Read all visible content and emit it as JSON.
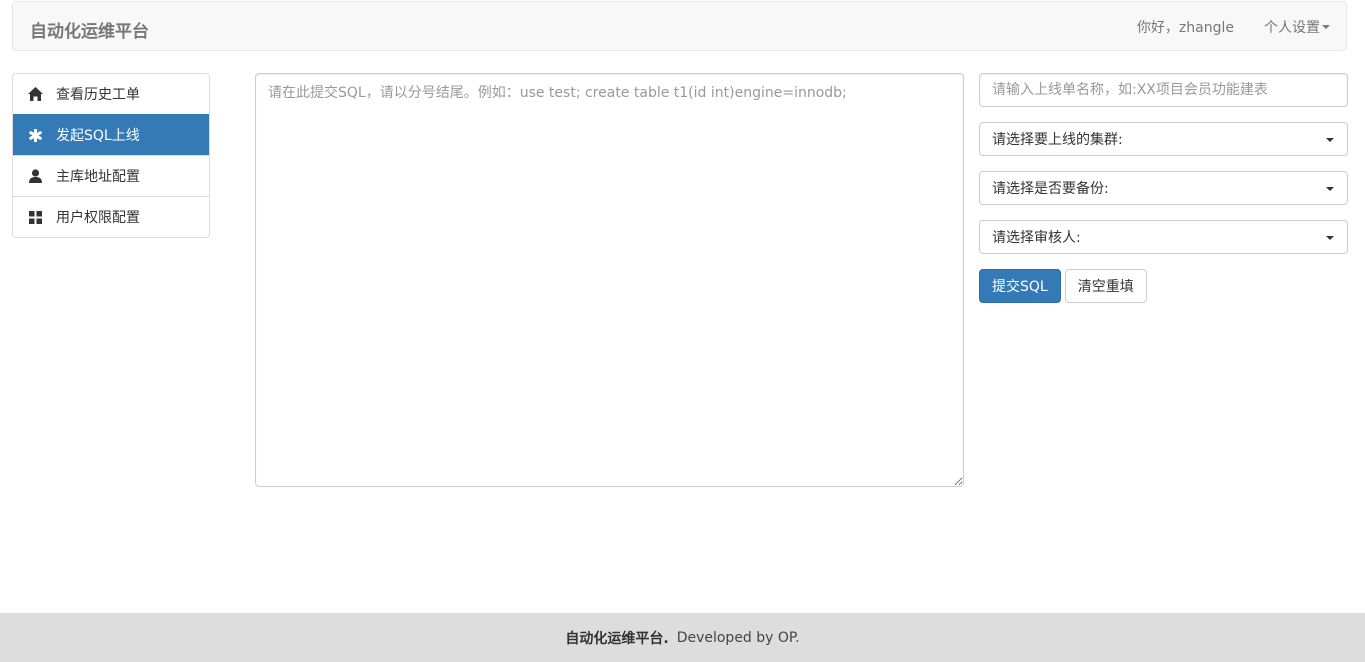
{
  "navbar": {
    "brand": "自动化运维平台",
    "greeting": "你好，zhangle",
    "personal_settings": "个人设置"
  },
  "sidebar": {
    "items": [
      {
        "label": "查看历史工单",
        "icon": "home-icon",
        "active": false
      },
      {
        "label": "发起SQL上线",
        "icon": "asterisk-icon",
        "active": true
      },
      {
        "label": "主库地址配置",
        "icon": "user-icon",
        "active": false
      },
      {
        "label": "用户权限配置",
        "icon": "grid-icon",
        "active": false
      }
    ]
  },
  "editor": {
    "placeholder": "请在此提交SQL，请以分号结尾。例如：use test; create table t1(id int)engine=innodb;",
    "value": ""
  },
  "form": {
    "title_placeholder": "请输入上线单名称，如:XX项目会员功能建表",
    "cluster_select": "请选择要上线的集群:",
    "backup_select": "请选择是否要备份:",
    "reviewer_select": "请选择审核人:",
    "submit_label": "提交SQL",
    "reset_label": "清空重填"
  },
  "footer": {
    "brand": "自动化运维平台.",
    "developed_by": "Developed by OP."
  },
  "colors": {
    "primary": "#337ab7",
    "navbar_bg": "#f8f8f8",
    "footer_bg": "#dddddd"
  }
}
